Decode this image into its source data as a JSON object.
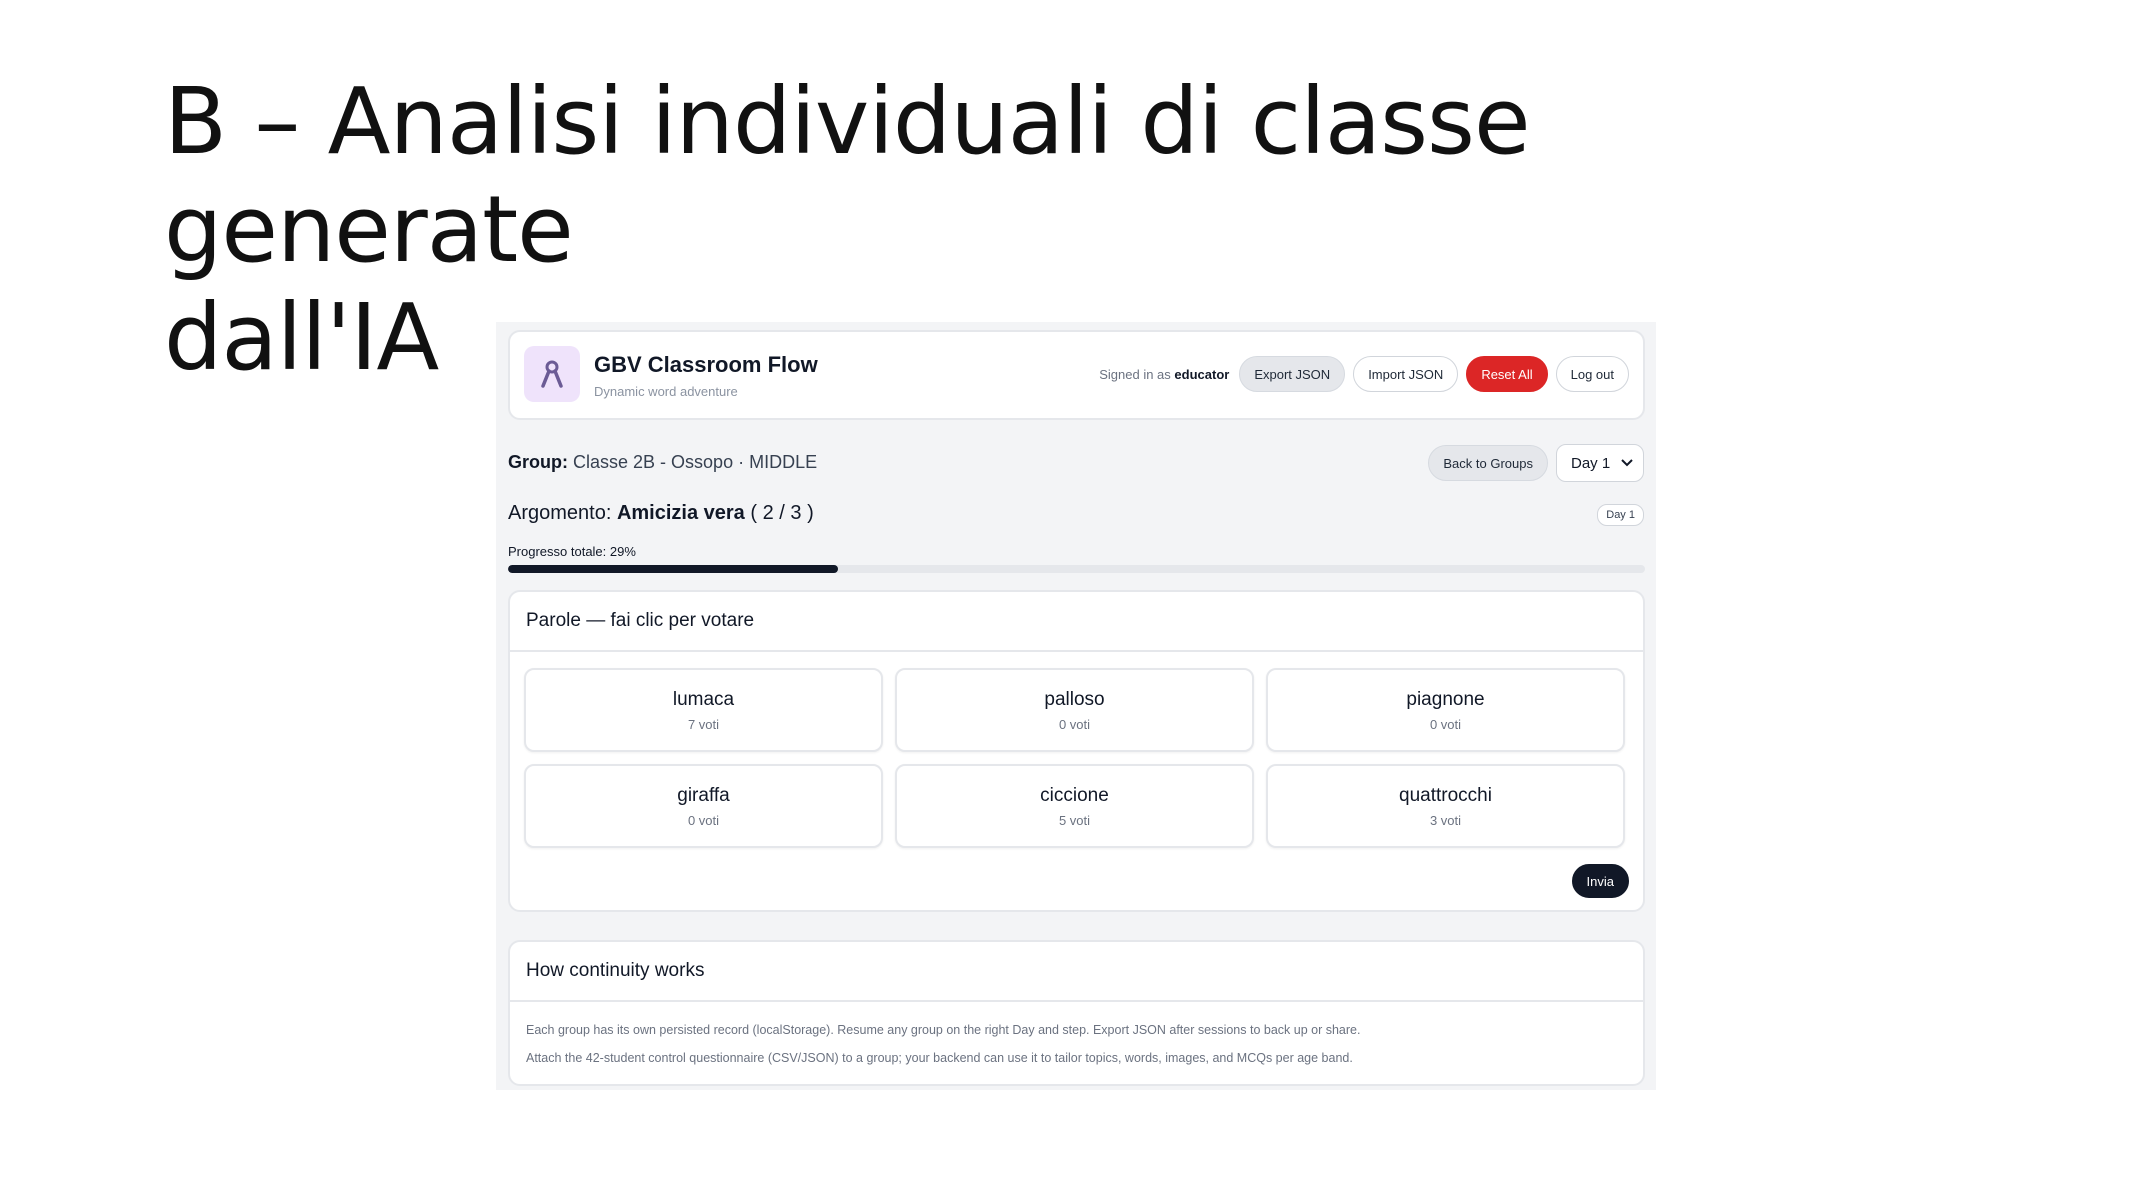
{
  "slide": {
    "title_line1": "B – Analisi individuali di classe generate",
    "title_line2": "dall'IA"
  },
  "app": {
    "title": "GBV Classroom Flow",
    "subtitle": "Dynamic word adventure",
    "logo_icon": "ribbon-icon",
    "accent": "#111827",
    "danger": "#dc2626"
  },
  "header": {
    "signed_in_prefix": "Signed in as",
    "signed_in_user": "educator",
    "export_label": "Export JSON",
    "import_label": "Import JSON",
    "reset_label": "Reset All",
    "logout_label": "Log out"
  },
  "group": {
    "label": "Group:",
    "value": "Classe 2B - Ossopo · MIDDLE",
    "back_label": "Back to Groups",
    "day_selected": "Day 1"
  },
  "topic": {
    "label": "Argomento:",
    "name": "Amicizia vera",
    "step": "( 2 / 3 )",
    "day_badge": "Day 1"
  },
  "progress": {
    "label": "Progresso totale: 29%",
    "percent": 29
  },
  "words_card": {
    "title": "Parole — fai clic per votare",
    "tiles": [
      {
        "word": "lumaca",
        "votes": "7 voti"
      },
      {
        "word": "palloso",
        "votes": "0 voti"
      },
      {
        "word": "piagnone",
        "votes": "0 voti"
      },
      {
        "word": "giraffa",
        "votes": "0 voti"
      },
      {
        "word": "ciccione",
        "votes": "5 voti"
      },
      {
        "word": "quattrocchi",
        "votes": "3 voti"
      }
    ],
    "submit_label": "Invia"
  },
  "info_card": {
    "title": "How continuity works",
    "line1": "Each group has its own persisted record (localStorage). Resume any group on the right Day and step. Export JSON after sessions to back up or share.",
    "line2": "Attach the 42-student control questionnaire (CSV/JSON) to a group; your backend can use it to tailor topics, words, images, and MCQs per age band."
  }
}
